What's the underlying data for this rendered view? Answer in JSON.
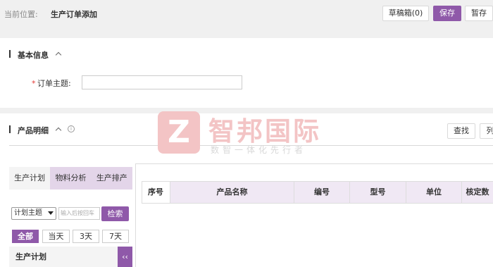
{
  "header": {
    "crumb_label": "当前位置:",
    "crumb_current": "生产订单添加",
    "draft_button": "草稿箱(0)",
    "save_button": "保存",
    "temp_save_button": "暂存"
  },
  "basic_info": {
    "title": "基本信息",
    "required_mark": "*",
    "order_subject_label": "订单主题:",
    "order_subject_value": ""
  },
  "product_detail": {
    "title": "产品明细",
    "info_icon": "i",
    "find_button": "查找",
    "column_button": "列"
  },
  "watermark": {
    "logo_letter": "Z",
    "title": "智邦国际",
    "subtitle": "数智一体化先行者"
  },
  "left_panel": {
    "tabs": [
      "生产计划",
      "物料分析",
      "生产排产"
    ],
    "active_tab_index": 0,
    "select_value": "计划主题",
    "search_placeholder": "输入后按回车",
    "search_button": "检索",
    "range_buttons": [
      "全部",
      "当天",
      "3天",
      "7天"
    ],
    "active_range_index": 0,
    "plan_header": "生产计划",
    "collapse_icon": "‹‹"
  },
  "grid": {
    "columns": [
      "序号",
      "产品名称",
      "编号",
      "型号",
      "单位",
      "核定数"
    ]
  },
  "colors": {
    "accent": "#8f59a9",
    "tab_bg": "#e3d5e9",
    "watermark": "#f3c4c5"
  }
}
